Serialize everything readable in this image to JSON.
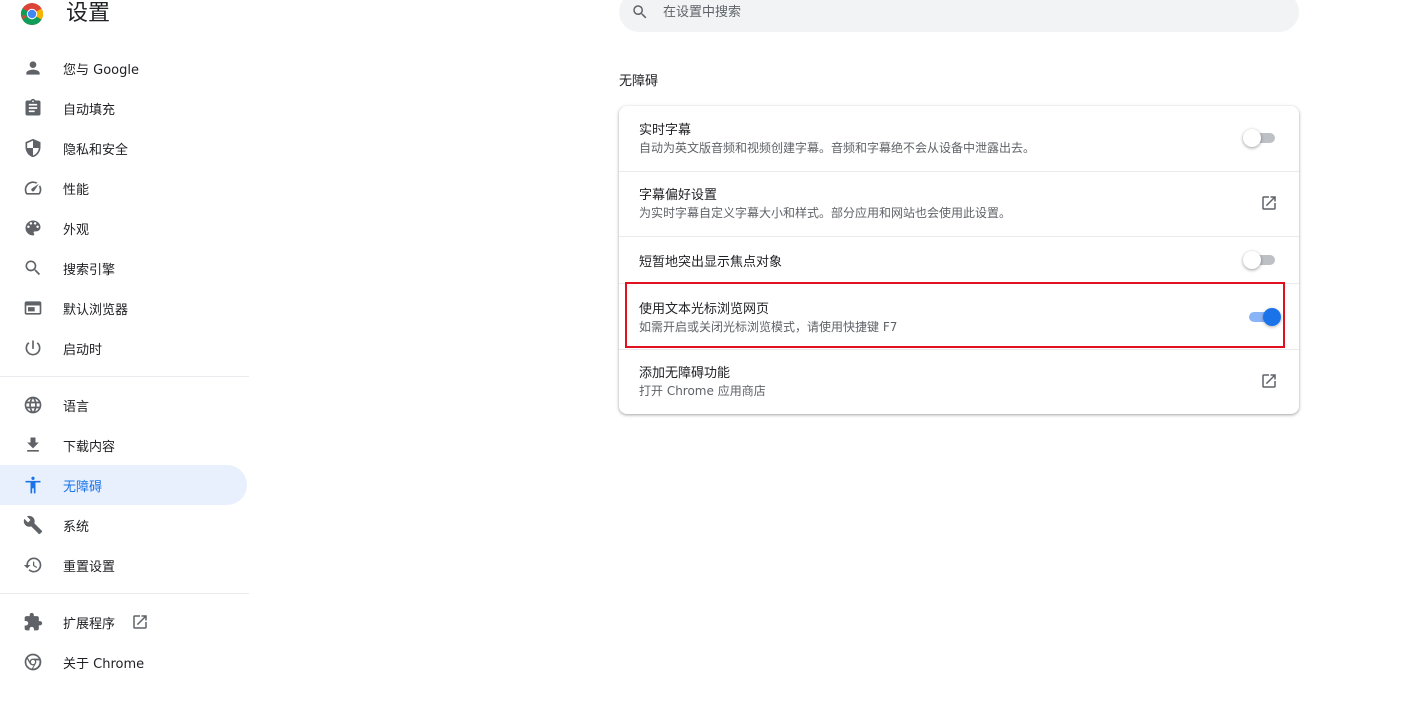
{
  "app": {
    "title": "设置"
  },
  "search": {
    "placeholder": "在设置中搜索"
  },
  "sidebar": {
    "group1": [
      {
        "label": "您与 Google",
        "icon": "person-icon"
      },
      {
        "label": "自动填充",
        "icon": "clipboard-icon"
      },
      {
        "label": "隐私和安全",
        "icon": "shield-icon"
      },
      {
        "label": "性能",
        "icon": "speedometer-icon"
      },
      {
        "label": "外观",
        "icon": "palette-icon"
      },
      {
        "label": "搜索引擎",
        "icon": "search-icon"
      },
      {
        "label": "默认浏览器",
        "icon": "browser-window-icon"
      },
      {
        "label": "启动时",
        "icon": "power-icon"
      }
    ],
    "group2": [
      {
        "label": "语言",
        "icon": "globe-icon"
      },
      {
        "label": "下载内容",
        "icon": "download-icon"
      },
      {
        "label": "无障碍",
        "icon": "accessibility-icon",
        "active": true
      },
      {
        "label": "系统",
        "icon": "wrench-icon"
      },
      {
        "label": "重置设置",
        "icon": "history-icon"
      }
    ],
    "group3": [
      {
        "label": "扩展程序",
        "icon": "puzzle-icon"
      },
      {
        "label": "关于 Chrome",
        "icon": "chrome-icon"
      }
    ]
  },
  "section": {
    "title": "无障碍",
    "rows": [
      {
        "title": "实时字幕",
        "subtitle": "自动为英文版音频和视频创建字幕。音频和字幕绝不会从设备中泄露出去。",
        "control": "toggle",
        "on": false
      },
      {
        "title": "字幕偏好设置",
        "subtitle": "为实时字幕自定义字幕大小和样式。部分应用和网站也会使用此设置。",
        "control": "launch"
      },
      {
        "title": "短暂地突出显示焦点对象",
        "control": "toggle",
        "on": false
      },
      {
        "title": "使用文本光标浏览网页",
        "subtitle": "如需开启或关闭光标浏览模式，请使用快捷键 F7",
        "control": "toggle",
        "on": true,
        "highlighted": true
      },
      {
        "title": "添加无障碍功能",
        "subtitle": "打开 Chrome 应用商店",
        "control": "launch"
      }
    ]
  },
  "colors": {
    "accent": "#1a73e8",
    "active_bg": "#e8f0fe",
    "highlight_border": "#e0121f"
  }
}
